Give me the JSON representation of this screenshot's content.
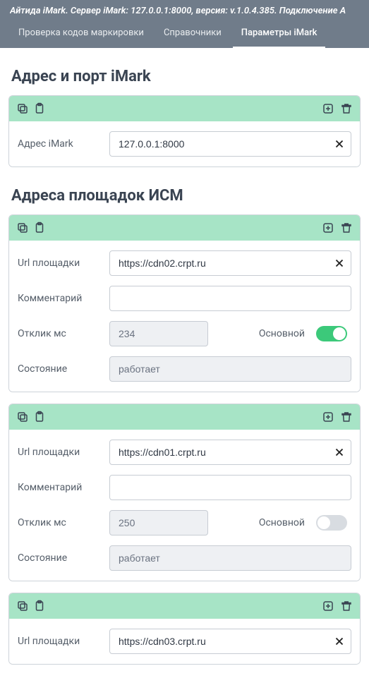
{
  "header": {
    "title": "Айтида iMark. Сервер iMark: 127.0.0.1:8000, версия: v.1.0.4.385. Подключение A"
  },
  "tabs": [
    {
      "label": "Проверка кодов маркировки",
      "active": false
    },
    {
      "label": "Справочники",
      "active": false
    },
    {
      "label": "Параметры iMark",
      "active": true
    }
  ],
  "section1": {
    "title": "Адрес и порт iMark",
    "labels": {
      "address": "Адрес iMark"
    },
    "values": {
      "address": "127.0.0.1:8000"
    }
  },
  "section2": {
    "title": "Адреса площадок ИСМ",
    "labels": {
      "url": "Url площадки",
      "comment": "Комментарий",
      "ping": "Отклик мс",
      "state": "Состояние",
      "primary": "Основной"
    },
    "items": [
      {
        "url": "https://cdn02.crpt.ru",
        "comment": "",
        "ping": "234",
        "state": "работает",
        "primary": true
      },
      {
        "url": "https://cdn01.crpt.ru",
        "comment": "",
        "ping": "250",
        "state": "работает",
        "primary": false
      },
      {
        "url": "https://cdn03.crpt.ru",
        "comment": "",
        "ping": "",
        "state": "",
        "primary": false
      }
    ]
  }
}
